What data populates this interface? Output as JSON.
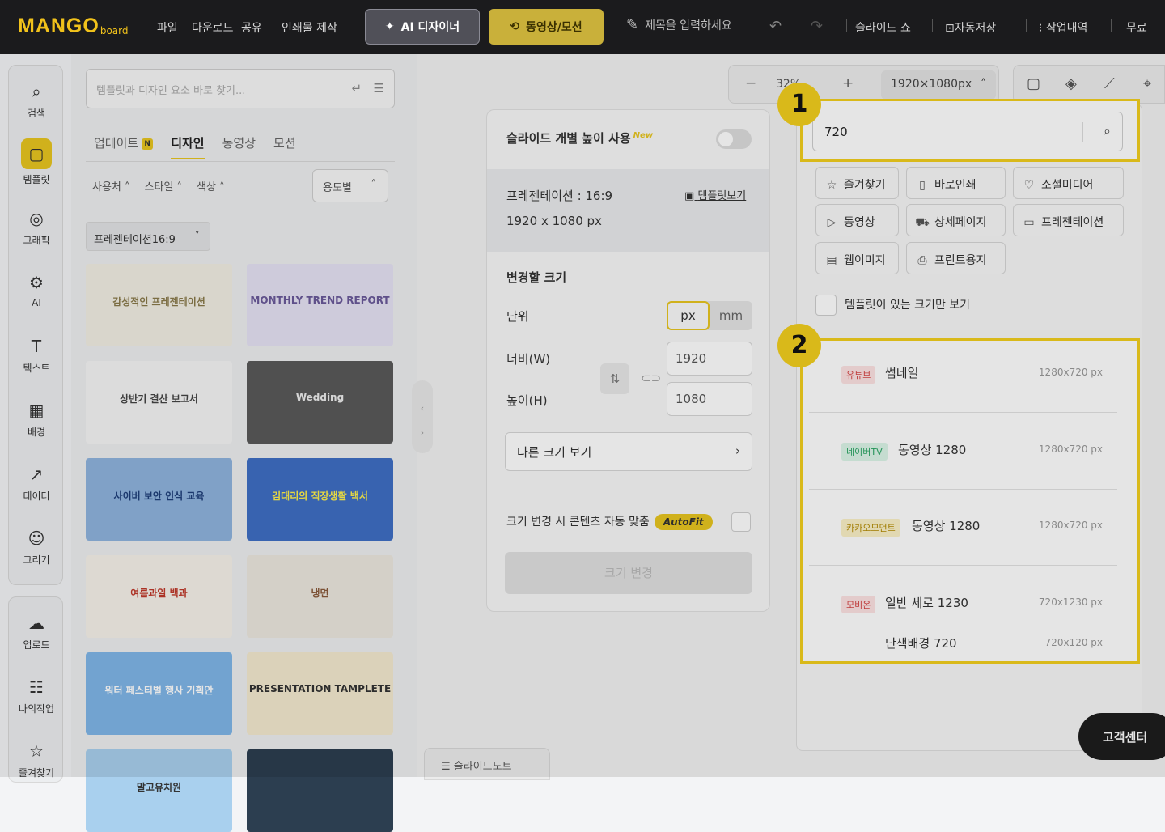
{
  "app": {
    "logo_main": "MANGO",
    "logo_sub": "board"
  },
  "topbar": {
    "menu": [
      "파일",
      "다운로드",
      "공유",
      "인쇄물 제작"
    ],
    "ai_button": "AI 디자이너",
    "video_button": "동영상/모션",
    "title_placeholder": "제목을 입력하세요",
    "right": [
      "슬라이드 쇼",
      "자동저장",
      "작업내역",
      "무료"
    ]
  },
  "rail": {
    "items": [
      {
        "label": "검색",
        "icon": "search-icon"
      },
      {
        "label": "템플릿",
        "icon": "template-icon"
      },
      {
        "label": "그래픽",
        "icon": "graphic-icon"
      },
      {
        "label": "AI",
        "icon": "ai-chip-icon"
      },
      {
        "label": "텍스트",
        "icon": "text-icon"
      },
      {
        "label": "배경",
        "icon": "background-icon"
      },
      {
        "label": "데이터",
        "icon": "chart-icon"
      },
      {
        "label": "그리기",
        "icon": "draw-icon"
      }
    ],
    "bottom": [
      {
        "label": "업로드",
        "icon": "upload-icon"
      },
      {
        "label": "나의작업",
        "icon": "my-work-icon"
      },
      {
        "label": "즐겨찾기",
        "icon": "favorite-icon"
      }
    ]
  },
  "panel": {
    "search_placeholder": "템플릿과 디자인 요소 바로 찾기...",
    "tabs": [
      "업데이트",
      "디자인",
      "동영상",
      "모션"
    ],
    "update_badge": "N",
    "filters": [
      "사용처",
      "스타일",
      "색상"
    ],
    "use_button": "용도별",
    "preset": "프레젠테이션16:9",
    "thumbs": [
      {
        "text": "감성적인 프레젠테이션",
        "bg": "#f2efe4",
        "fg": "#8a7a4a"
      },
      {
        "text": "MONTHLY TREND REPORT",
        "bg": "#e6e2f4",
        "fg": "#6a5a9a"
      },
      {
        "text": "상반기 결산 보고서",
        "bg": "#f5f5f5",
        "fg": "#444"
      },
      {
        "text": "Wedding",
        "bg": "#5a5a5a",
        "fg": "#eee"
      },
      {
        "text": "사이버 보안 인식 교육",
        "bg": "#8fb4de",
        "fg": "#1f3f7a"
      },
      {
        "text": "김대리의 직장생활 백서",
        "bg": "#3f6fc4",
        "fg": "#fff04a"
      },
      {
        "text": "여름과일 백과",
        "bg": "#f6f2ea",
        "fg": "#c0392b"
      },
      {
        "text": "냉면",
        "bg": "#ede8df",
        "fg": "#8a5a3a"
      },
      {
        "text": "워터 페스티벌 행사 기획안",
        "bg": "#7fb6e8",
        "fg": "#fff"
      },
      {
        "text": "PRESENTATION TAMPLETE",
        "bg": "#f4ead0",
        "fg": "#333"
      },
      {
        "text": "말고유치원",
        "bg": "#a9d0ee",
        "fg": "#333"
      },
      {
        "text": "",
        "bg": "#2c3e50",
        "fg": "#fff"
      }
    ]
  },
  "size_panel": {
    "individual_height": "슬라이드 개별 높이 사용",
    "new_badge": "New",
    "current_type": "프레젠테이션 : 16:9",
    "template_view": "템플릿보기",
    "current_size": "1920 x 1080 px",
    "change_size": "변경할 크기",
    "unit_label": "단위",
    "unit_px": "px",
    "unit_mm": "mm",
    "width_label": "너비(W)",
    "height_label": "높이(H)",
    "width_value": "1920",
    "height_value": "1080",
    "other_sizes": "다른 크기 보기",
    "autofit_label": "크기 변경 시 콘텐츠 자동 맞춤",
    "autofit_badge": "AutoFit",
    "apply": "크기 변경"
  },
  "zoom": {
    "value": "32%",
    "size_chip": "1920×1080px"
  },
  "size_search": {
    "value": "720",
    "categories": [
      {
        "label": "즐겨찾기",
        "icon": "star-icon"
      },
      {
        "label": "바로인쇄",
        "icon": "book-icon"
      },
      {
        "label": "소셜미디어",
        "icon": "social-icon"
      },
      {
        "label": "동영상",
        "icon": "video-icon"
      },
      {
        "label": "상세페이지",
        "icon": "detail-page-icon"
      },
      {
        "label": "프레젠테이션",
        "icon": "presentation-icon"
      },
      {
        "label": "웹이미지",
        "icon": "web-image-icon"
      },
      {
        "label": "프린트용지",
        "icon": "printer-icon"
      }
    ],
    "only_template": "템플릿이 있는 크기만 보기",
    "results": [
      {
        "tag": "유튜브",
        "name": "썸네일",
        "size": "1280x720 px",
        "tag_bg": "#fde3e3",
        "tag_fg": "#d64545"
      },
      {
        "tag": "네이버TV",
        "name": "동영상 1280",
        "size": "1280x720 px",
        "tag_bg": "#dcf5e8",
        "tag_fg": "#2aa564"
      },
      {
        "tag": "카카오모먼트",
        "name": "동영상 1280",
        "size": "1280x720 px",
        "tag_bg": "#fbf1c7",
        "tag_fg": "#b38a00"
      },
      {
        "tag": "모비온",
        "name": "일반 세로 1230",
        "size": "720x1230 px",
        "tag_bg": "#fde3e3",
        "tag_fg": "#d64545"
      },
      {
        "tag": "",
        "name": "단색배경 720",
        "size": "720x120 px",
        "tag_bg": "",
        "tag_fg": ""
      }
    ]
  },
  "annotations": [
    "1",
    "2"
  ],
  "slide_note": "슬라이드노트",
  "help": "고객센터"
}
